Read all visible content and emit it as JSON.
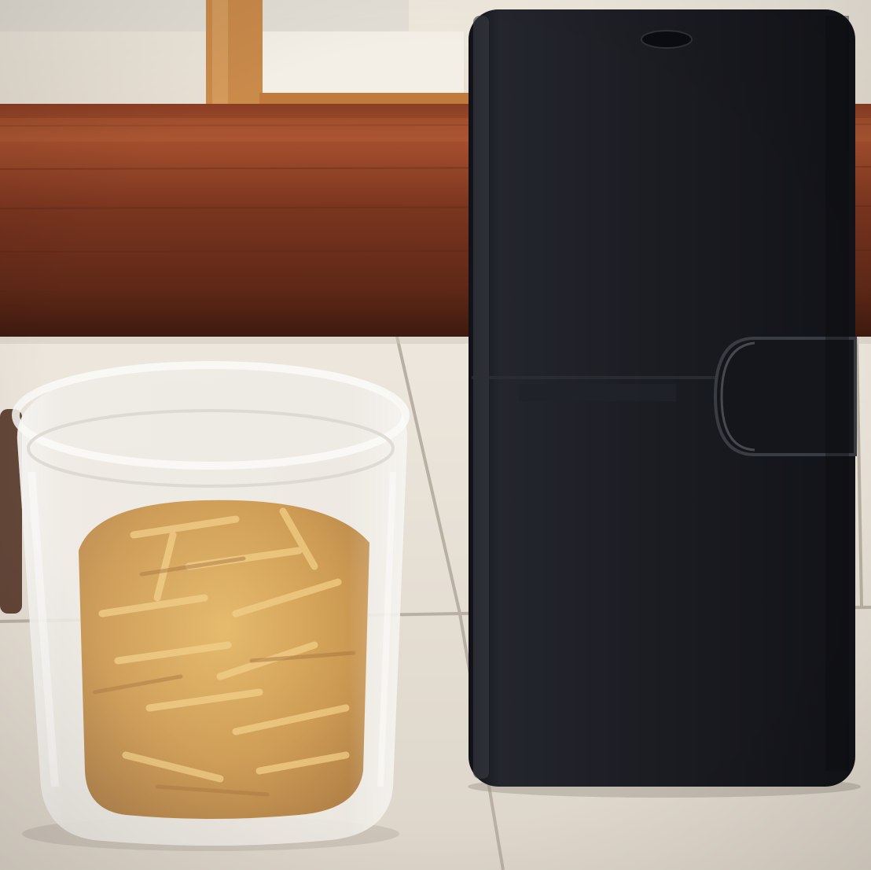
{
  "scene": {
    "description_free": true,
    "objects": [
      {
        "name": "wooden-rail",
        "color": "#6a2f1c"
      },
      {
        "name": "chair-backrest",
        "color": "#c98a4a"
      },
      {
        "name": "tiled-countertop",
        "color": "#e6e0d6"
      },
      {
        "name": "glass-tumbler",
        "color": "#f2f2ee"
      },
      {
        "name": "dry-pasta",
        "color": "#c8963e"
      },
      {
        "name": "phone-wallet-case",
        "color": "#17181c"
      }
    ]
  }
}
